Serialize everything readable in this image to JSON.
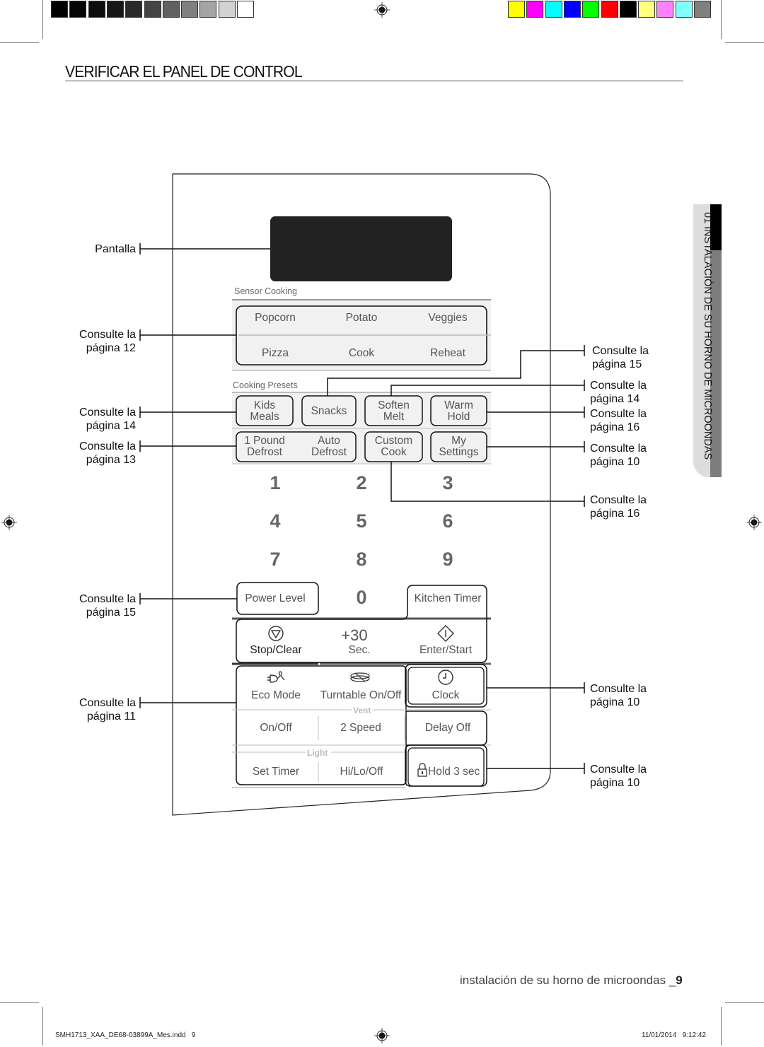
{
  "print_marks": {
    "grayscale_swatches": [
      "#000000",
      "#050505",
      "#0d0d0d",
      "#181818",
      "#2a2a2a",
      "#444444",
      "#606060",
      "#808080",
      "#a4a4a4",
      "#d2d2d2",
      "#ffffff"
    ],
    "color_swatches": [
      "#ffff00",
      "#ff00ff",
      "#00ffff",
      "#0000ff",
      "#00ff00",
      "#ff0000",
      "#000000",
      "#ffff80",
      "#ff80ff",
      "#80ffff",
      "#808080"
    ],
    "registration_icon": "registration-target-icon"
  },
  "header": {
    "title": "VERIFICAR EL PANEL DE CONTROL"
  },
  "side_tab": {
    "label": "01 INSTALACIÓN DE SU HORNO DE MICROONDAS"
  },
  "callouts_left": [
    {
      "line1": "Pantalla",
      "line2": ""
    },
    {
      "line1": "Consulte la",
      "line2": "página 12"
    },
    {
      "line1": "Consulte la",
      "line2": "página 14"
    },
    {
      "line1": "Consulte la",
      "line2": "página 13"
    },
    {
      "line1": "Consulte la",
      "line2": "página 15"
    },
    {
      "line1": "Consulte la",
      "line2": "página 11"
    }
  ],
  "callouts_right": [
    {
      "line1": "Consulte la",
      "line2": "página 15"
    },
    {
      "line1": "Consulte la",
      "line2": "página 14"
    },
    {
      "line1": "Consulte la",
      "line2": "página 16"
    },
    {
      "line1": "Consulte la",
      "line2": "página 10"
    },
    {
      "line1": "Consulte la",
      "line2": "página 16"
    },
    {
      "line1": "Consulte la",
      "line2": "página 10"
    },
    {
      "line1": "Consulte la",
      "line2": "página 10"
    }
  ],
  "panel": {
    "sensor_section": "Sensor Cooking",
    "sensor_buttons": [
      "Popcorn",
      "Potato",
      "Veggies",
      "Pizza",
      "Cook",
      "Reheat"
    ],
    "presets_section": "Cooking Presets",
    "presets": {
      "kids_meals": [
        "Kids",
        "Meals"
      ],
      "snacks": "Snacks",
      "soften_melt": [
        "Soften",
        "Melt"
      ],
      "warm_hold": [
        "Warm",
        "Hold"
      ],
      "pound_defrost": [
        "1 Pound",
        "Defrost"
      ],
      "auto_defrost": [
        "Auto",
        "Defrost"
      ],
      "custom_cook": [
        "Custom",
        "Cook"
      ],
      "my_settings": [
        "My",
        "Settings"
      ]
    },
    "keypad": [
      "1",
      "2",
      "3",
      "4",
      "5",
      "6",
      "7",
      "8",
      "9",
      "0"
    ],
    "power_level": "Power Level",
    "kitchen_timer": "Kitchen Timer",
    "stop_clear": "Stop/Clear",
    "plus30": "+30",
    "plus30_sub": "Sec.",
    "enter_start": "Enter/Start",
    "eco_mode": "Eco Mode",
    "turntable": "Turntable On/Off",
    "clock": "Clock",
    "vent_group": "Vent",
    "vent_onoff": "On/Off",
    "vent_speed": "2 Speed",
    "vent_delay": "Delay Off",
    "light_group": "Light",
    "set_timer": "Set Timer",
    "light_hilo": "Hi/Lo/Off",
    "hold3": "Hold 3 sec"
  },
  "footer": {
    "section": "instalación de su horno de microondas _",
    "page": "9",
    "slug_file": "SMH1713_XAA_DE68-03899A_Mes.indd   9",
    "slug_date": "11/01/2014   9:12:42"
  }
}
